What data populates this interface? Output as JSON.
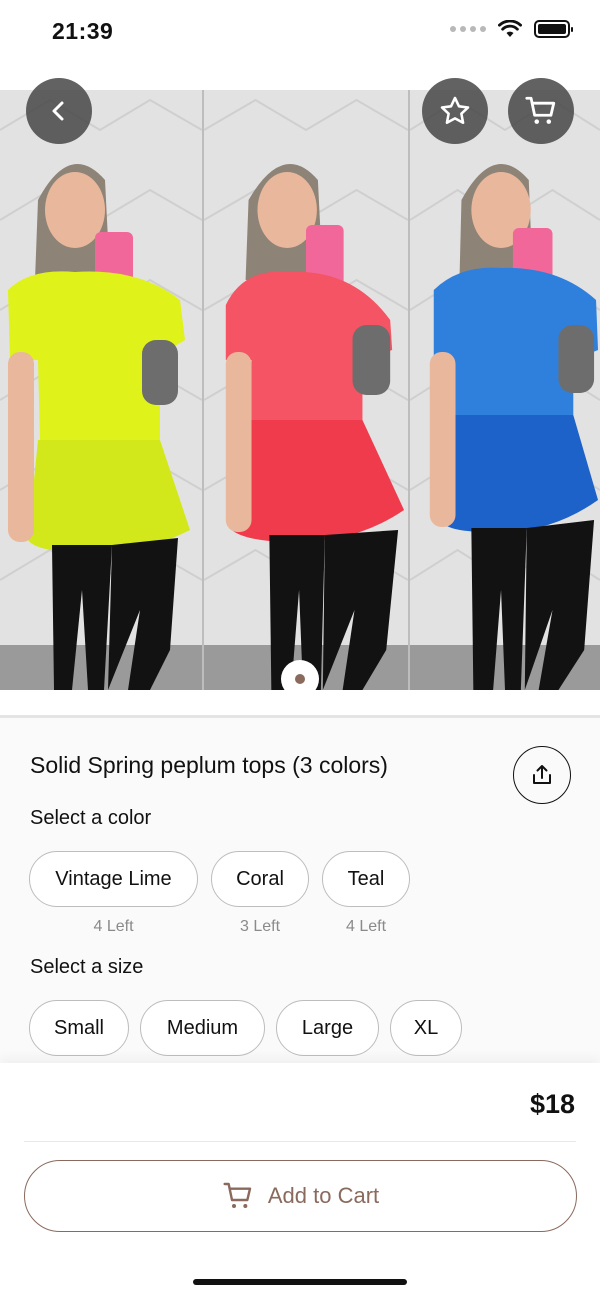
{
  "status_bar": {
    "time": "21:39"
  },
  "hero": {
    "image_description_colors": [
      "#dff21a",
      "#f45463",
      "#1d74d4"
    ],
    "current_page": 1
  },
  "product": {
    "title": "Solid Spring peplum tops (3 colors)",
    "price": "$18"
  },
  "color_section": {
    "label": "Select a color",
    "options": [
      {
        "name": "Vintage Lime",
        "stock": "4 Left"
      },
      {
        "name": "Coral",
        "stock": "3 Left"
      },
      {
        "name": "Teal",
        "stock": "4 Left"
      }
    ]
  },
  "size_section": {
    "label": "Select a size",
    "options": [
      "Small",
      "Medium",
      "Large",
      "XL"
    ]
  },
  "actions": {
    "add_to_cart": "Add to Cart"
  },
  "icons": {
    "back": "chevron-left-icon",
    "favorite": "star-icon",
    "cart": "cart-icon",
    "share": "share-icon"
  },
  "colors": {
    "accent": "#8a6a5d",
    "chip_border": "#bdbdbd",
    "hero_button_bg": "#464646"
  }
}
